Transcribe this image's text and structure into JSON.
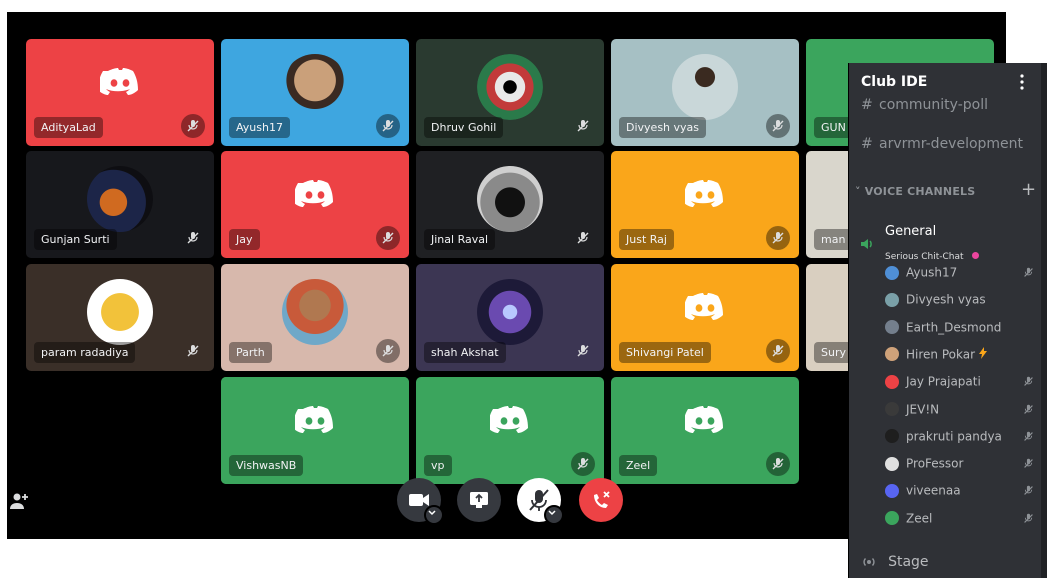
{
  "tiles": [
    {
      "name": "AdityaLad",
      "bg": "#ed4245",
      "kind": "logo",
      "muted": true
    },
    {
      "name": "Ayush17",
      "bg": "#3ea6e0",
      "kind": "avatar",
      "muted": true
    },
    {
      "name": "Dhruv Gohil",
      "bg": "#2a3a30",
      "kind": "avatar",
      "muted": true
    },
    {
      "name": "Divyesh vyas",
      "bg": "#a6c0c4",
      "kind": "avatar",
      "muted": true
    },
    {
      "name": "GUN",
      "bg": "#3ba55d",
      "kind": "logo",
      "muted": false
    },
    {
      "name": "Gunjan Surti",
      "bg": "#17181c",
      "kind": "avatar",
      "muted": true
    },
    {
      "name": "Jay",
      "bg": "#ed4245",
      "kind": "logo",
      "muted": true
    },
    {
      "name": "Jinal Raval",
      "bg": "#1f2023",
      "kind": "avatar",
      "muted": true
    },
    {
      "name": "Just Raj",
      "bg": "#faa61a",
      "kind": "logo",
      "muted": true
    },
    {
      "name": "man",
      "bg": "#d9d6cc",
      "kind": "logo",
      "muted": false
    },
    {
      "name": "param radadiya",
      "bg": "#3a2f28",
      "kind": "avatar",
      "muted": true
    },
    {
      "name": "Parth",
      "bg": "#d7b8ac",
      "kind": "avatar",
      "muted": true
    },
    {
      "name": "shah Akshat",
      "bg": "#3c3653",
      "kind": "avatar",
      "muted": true
    },
    {
      "name": "Shivangi Patel",
      "bg": "#faa61a",
      "kind": "logo",
      "muted": true
    },
    {
      "name": "Sury",
      "bg": "#d9cfc0",
      "kind": "logo",
      "muted": false
    },
    {
      "name": "VishwasNB",
      "bg": "#3ba55d",
      "kind": "logo",
      "muted": false
    },
    {
      "name": "vp",
      "bg": "#3ba55d",
      "kind": "logo",
      "muted": true
    },
    {
      "name": "Zeel",
      "bg": "#3ba55d",
      "kind": "logo",
      "muted": true
    }
  ],
  "controls": {
    "camera_icon": "camera-icon",
    "screen_share_icon": "screen-share-icon",
    "mic_icon": "microphone-muted-icon",
    "disconnect_icon": "phone-hangup-icon",
    "invite_icon": "add-user-icon",
    "disconnect_color": "#ed4245"
  },
  "sidebar": {
    "server_name": "Club IDE",
    "menu_icon": "vertical-dots-icon",
    "text_channels": [
      "community-poll",
      "arvrmr-development"
    ],
    "voice_category": "VOICE CHANNELS",
    "add_icon": "plus-icon",
    "voice_channel": {
      "name": "General",
      "topic": "Serious Chit-Chat",
      "icon": "speaker-icon"
    },
    "voice_users": [
      {
        "name": "Ayush17",
        "color": "#4f8fd6",
        "muted": true
      },
      {
        "name": "Divyesh vyas",
        "color": "#7aa0a8",
        "muted": false
      },
      {
        "name": "Earth_Desmond",
        "color": "#747f8d",
        "muted": false
      },
      {
        "name": "Hiren Pokar",
        "color": "#cfa27a",
        "muted": false,
        "boost": true
      },
      {
        "name": "Jay Prajapati",
        "color": "#ed4245",
        "muted": true
      },
      {
        "name": "JEV!N",
        "color": "#3a3a3a",
        "muted": true
      },
      {
        "name": "prakruti pandya",
        "color": "#1e1e1e",
        "muted": true
      },
      {
        "name": "ProFessor",
        "color": "#e0e0e0",
        "muted": true
      },
      {
        "name": "viveenaa",
        "color": "#5865f2",
        "muted": true
      },
      {
        "name": "Zeel",
        "color": "#3ba55d",
        "muted": true
      }
    ],
    "stage_channel": "Stage",
    "stage_icon": "stage-icon"
  }
}
